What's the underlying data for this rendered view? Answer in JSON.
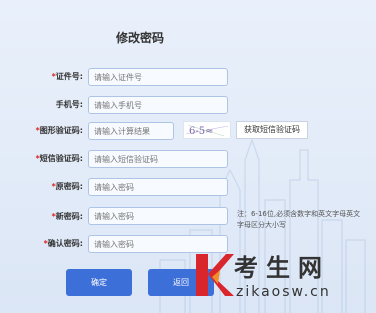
{
  "form": {
    "title": "修改密码",
    "fields": [
      {
        "label": "证件号:",
        "required": true,
        "placeholder": "请输入证件号"
      },
      {
        "label": "手机号:",
        "required": false,
        "placeholder": "请输入手机号"
      },
      {
        "label": "图形验证码:",
        "required": true,
        "placeholder": "请输入计算结果"
      },
      {
        "label": "短信验证码:",
        "required": true,
        "placeholder": "请输入短信验证码"
      },
      {
        "label": "原密码:",
        "required": true,
        "placeholder": "请输入密码"
      },
      {
        "label": "新密码:",
        "required": true,
        "placeholder": "请输入密码"
      },
      {
        "label": "确认密码:",
        "required": true,
        "placeholder": "请输入密码"
      }
    ],
    "captcha_text": "6-5≈",
    "sms_button": "获取短信验证码",
    "hint": "注：6-16位,必须含数字和英文字母英文字母区分大小写",
    "confirm_button": "确定",
    "back_button": "返回"
  },
  "watermark": {
    "cn": "考生网",
    "url": "zikaosw.cn"
  },
  "colors": {
    "primary": "#3d6fd9",
    "required_star": "#e02020",
    "logo_red": "#d9262c"
  }
}
